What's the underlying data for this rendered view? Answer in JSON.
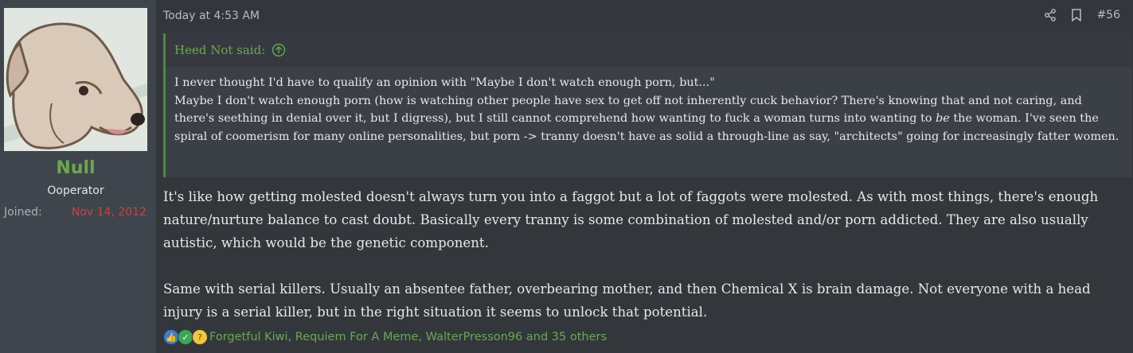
{
  "user": {
    "name": "Null",
    "title": "Ooperator",
    "joined_label": "Joined:",
    "joined_date": "Nov 14, 2012",
    "avatar_icon": "dog-avatar-icon"
  },
  "post": {
    "date": "Today at 4:53 AM",
    "number": "#56",
    "quote": {
      "author": "Heed Not said:",
      "line1": "I never thought I'd have to qualify an opinion with \"Maybe I don't watch enough porn, but...\"",
      "line2_pre": "Maybe I don't watch enough porn (how is watching other people have sex to get off not inherently cuck behavior? There's knowing that and not caring, and there's seething in denial over it, but I digress), but I still cannot comprehend how wanting to fuck a woman turns into wanting to ",
      "line2_em": "be",
      "line2_post": " the woman. I've seen the spiral of coomerism for many online personalities, but porn -> tranny doesn't have as solid a through-line as say, \"architects\" going for increasingly fatter women."
    },
    "paragraph1": "It's like how getting molested doesn't always turn you into a faggot but a lot of faggots were molested. As with most things, there's enough nature/nurture balance to cast doubt. Basically every tranny is some combination of molested and/or porn addicted. They are also usually autistic, which would be the genetic component.",
    "paragraph2": "Same with serial killers. Usually an absentee father, overbearing mother, and then Chemical X is brain damage. Not everyone with a head injury is a serial killer, but in the right situation it seems to unlock that potential.",
    "reactions_text": "Forgetful Kiwi, Requiem For A Meme, WalterPresson96 and 35 others"
  },
  "colors": {
    "username": "#6aa84f",
    "joined_date": "#c8443f",
    "quote_bar": "#4d8a3f",
    "background": "#33373c",
    "sidebar": "#3f454c"
  }
}
